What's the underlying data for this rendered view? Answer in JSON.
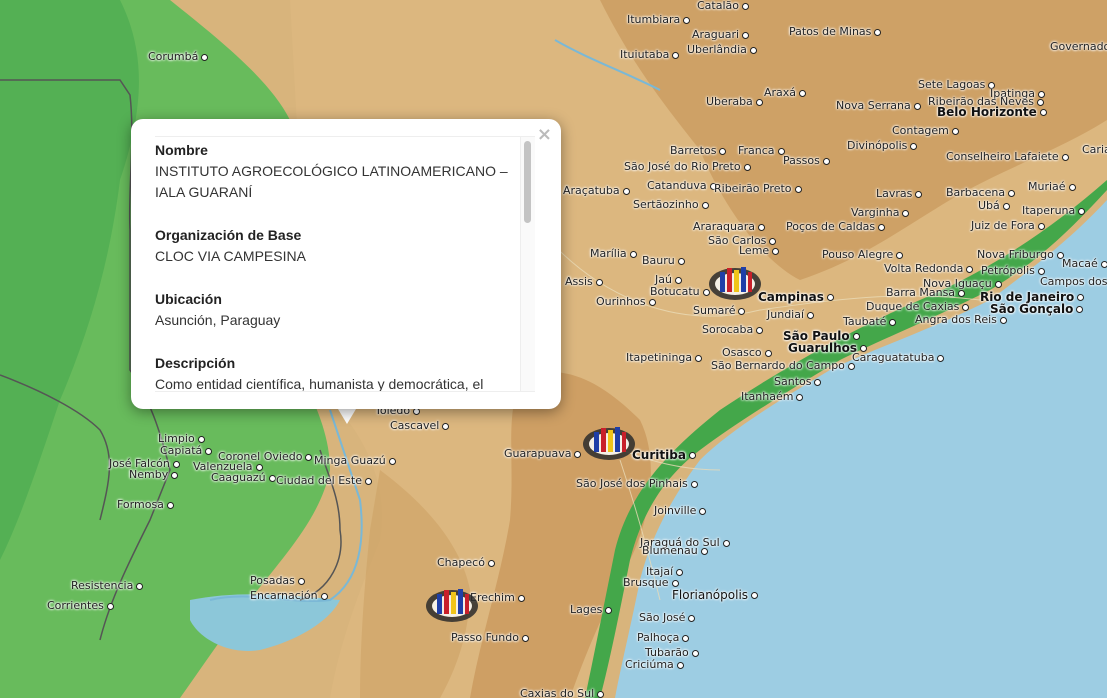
{
  "map": {
    "colors": {
      "ocean": "#9dcde3",
      "lowland": "#5fb85a",
      "highland": "#d8b47c",
      "mountain": "#c9965a"
    },
    "cities": [
      {
        "name": "Catalão"
      },
      {
        "name": "Itumbiara"
      },
      {
        "name": "Araguari"
      },
      {
        "name": "Uberlândia"
      },
      {
        "name": "Ituiutaba"
      },
      {
        "name": "Patos de Minas"
      },
      {
        "name": "Governado"
      },
      {
        "name": "Corumbá"
      },
      {
        "name": "Araxá"
      },
      {
        "name": "Uberaba"
      },
      {
        "name": "Sete Lagoas"
      },
      {
        "name": "Ipatinga"
      },
      {
        "name": "Ribeirão das Neves"
      },
      {
        "name": "Belo Horizonte"
      },
      {
        "name": "Nova Serrana"
      },
      {
        "name": "Contagem"
      },
      {
        "name": "Divinópolis"
      },
      {
        "name": "Barretos"
      },
      {
        "name": "Franca"
      },
      {
        "name": "Passos"
      },
      {
        "name": "Conselheiro Lafaiete"
      },
      {
        "name": "Caria"
      },
      {
        "name": "São José do Rio Preto"
      },
      {
        "name": "Araçatuba"
      },
      {
        "name": "Catanduva"
      },
      {
        "name": "Ribeirão Preto"
      },
      {
        "name": "Sertãozinho"
      },
      {
        "name": "Lavras"
      },
      {
        "name": "Barbacena"
      },
      {
        "name": "Muriaé"
      },
      {
        "name": "Ubá"
      },
      {
        "name": "Itaperuna"
      },
      {
        "name": "Varginha"
      },
      {
        "name": "Araraquara"
      },
      {
        "name": "São Carlos"
      },
      {
        "name": "Poços de Caldas"
      },
      {
        "name": "Juiz de Fora"
      },
      {
        "name": "Leme"
      },
      {
        "name": "Marília"
      },
      {
        "name": "Bauru"
      },
      {
        "name": "Pouso Alegre"
      },
      {
        "name": "Nova Friburgo"
      },
      {
        "name": "Macaé"
      },
      {
        "name": "Assis"
      },
      {
        "name": "Jaú"
      },
      {
        "name": "Botucatu"
      },
      {
        "name": "Volta Redonda"
      },
      {
        "name": "Petrópolis"
      },
      {
        "name": "Nova Iguaçu"
      },
      {
        "name": "Campos dos Ostras"
      },
      {
        "name": "Campinas"
      },
      {
        "name": "Barra Mansa"
      },
      {
        "name": "Rio de Janeiro"
      },
      {
        "name": "Ourinhos"
      },
      {
        "name": "Sumaré"
      },
      {
        "name": "Duque de Caxias"
      },
      {
        "name": "São Gonçalo"
      },
      {
        "name": "Jundiaí"
      },
      {
        "name": "Taubaté"
      },
      {
        "name": "Angra dos Reis"
      },
      {
        "name": "Sorocaba"
      },
      {
        "name": "São Paulo"
      },
      {
        "name": "Guarulhos"
      },
      {
        "name": "Osasco"
      },
      {
        "name": "Itapetininga"
      },
      {
        "name": "Caraguatatuba"
      },
      {
        "name": "São Bernardo do Campo"
      },
      {
        "name": "Santos"
      },
      {
        "name": "Itanhaém"
      },
      {
        "name": "Toledo"
      },
      {
        "name": "Cascavel"
      },
      {
        "name": "Limpio"
      },
      {
        "name": "Capiatá"
      },
      {
        "name": "Coronel Oviedo"
      },
      {
        "name": "José Falcón"
      },
      {
        "name": "Valenzuela"
      },
      {
        "name": "Minga Guazú"
      },
      {
        "name": "Nemby"
      },
      {
        "name": "Caaguazú"
      },
      {
        "name": "Ciudad del Este"
      },
      {
        "name": "Guarapuava"
      },
      {
        "name": "Curitiba"
      },
      {
        "name": "Formosa"
      },
      {
        "name": "São José dos Pinhais"
      },
      {
        "name": "Joinville"
      },
      {
        "name": "Jaraguá do Sul"
      },
      {
        "name": "Blumenau"
      },
      {
        "name": "Chapecó"
      },
      {
        "name": "Itajaí"
      },
      {
        "name": "Resistencia"
      },
      {
        "name": "Posadas"
      },
      {
        "name": "Brusque"
      },
      {
        "name": "Corrientes"
      },
      {
        "name": "Encarnación"
      },
      {
        "name": "Erechim"
      },
      {
        "name": "São José"
      },
      {
        "name": "Florianópolis"
      },
      {
        "name": "Lages"
      },
      {
        "name": "Passo Fundo"
      },
      {
        "name": "Palhoça"
      },
      {
        "name": "Tubarão"
      },
      {
        "name": "Criciúma"
      },
      {
        "name": "Caxias do Sul"
      }
    ]
  },
  "popup": {
    "close_symbol": "×",
    "fields": [
      {
        "label": "Nombre",
        "value": "INSTITUTO AGROECOLÓGICO LATINOAMERICANO – IALA GUARANÍ"
      },
      {
        "label": "Organización de Base",
        "value": "CLOC VIA CAMPESINA"
      },
      {
        "label": "Ubicación",
        "value": "Asunción, Paraguay"
      },
      {
        "label": "Descripción",
        "value": "Como entidad científica, humanista y democrática, el"
      }
    ]
  }
}
